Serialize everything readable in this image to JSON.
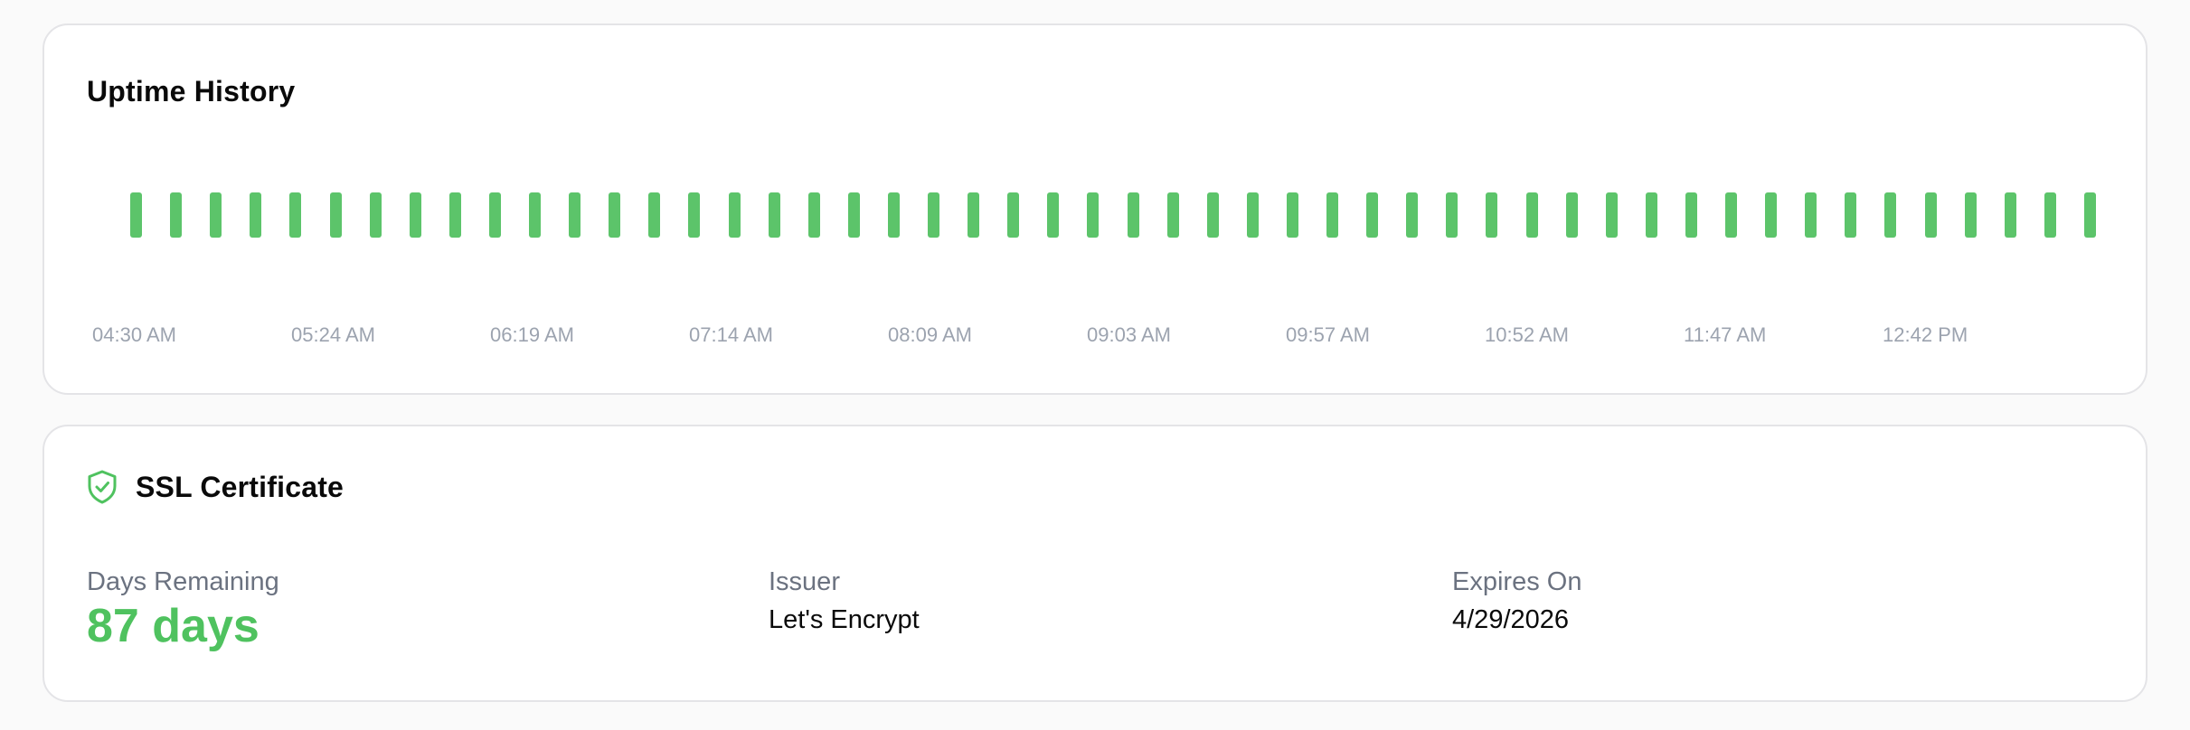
{
  "uptime": {
    "title": "Uptime History",
    "bar_color": "#5cc46a",
    "checks": [
      "up",
      "up",
      "up",
      "up",
      "up",
      "up",
      "up",
      "up",
      "up",
      "up",
      "up",
      "up",
      "up",
      "up",
      "up",
      "up",
      "up",
      "up",
      "up",
      "up",
      "up",
      "up",
      "up",
      "up",
      "up",
      "up",
      "up",
      "up",
      "up",
      "up",
      "up",
      "up",
      "up",
      "up",
      "up",
      "up",
      "up",
      "up",
      "up",
      "up",
      "up",
      "up",
      "up",
      "up",
      "up",
      "up",
      "up",
      "up",
      "up",
      "up"
    ],
    "time_labels": [
      "04:30 AM",
      "05:24 AM",
      "06:19 AM",
      "07:14 AM",
      "08:09 AM",
      "09:03 AM",
      "09:57 AM",
      "10:52 AM",
      "11:47 AM",
      "12:42 PM"
    ]
  },
  "ssl": {
    "title": "SSL Certificate",
    "icon": "shield-check-icon",
    "accent_color": "#4fc25f",
    "days_remaining_label": "Days Remaining",
    "days_remaining_value": "87 days",
    "issuer_label": "Issuer",
    "issuer_value": "Let's Encrypt",
    "expires_label": "Expires On",
    "expires_value": "4/29/2026"
  }
}
